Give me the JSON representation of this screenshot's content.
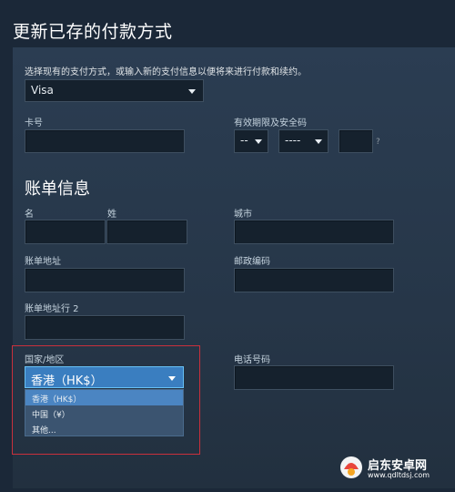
{
  "header": {
    "title": "更新已存的付款方式"
  },
  "payment": {
    "subtitle": "选择现有的支付方式，或输入新的支付信息以便将来进行付款和续约。",
    "method_selected": "Visa"
  },
  "card": {
    "number_label": "卡号",
    "expiry_label": "有效期限及安全码",
    "month_selected": "--",
    "year_selected": "----",
    "cvv_hint": "?"
  },
  "billing": {
    "section_title": "账单信息",
    "first_name_label": "名",
    "last_name_label": "姓",
    "city_label": "城市",
    "address_label": "账单地址",
    "postal_label": "邮政编码",
    "address2_label": "账单地址行 2",
    "country_label": "国家/地区",
    "phone_label": "电话号码",
    "country_selected": "香港（HK$）",
    "country_options": [
      "香港（HK$）",
      "中国（¥）",
      "其他..."
    ]
  },
  "watermark": {
    "name": "启东安卓网",
    "url": "www.qdltdsj.com"
  },
  "colors": {
    "highlight_box": "#c9303c",
    "selected_option": "#4b85c2",
    "panel_bg": "#2a3a4d"
  }
}
